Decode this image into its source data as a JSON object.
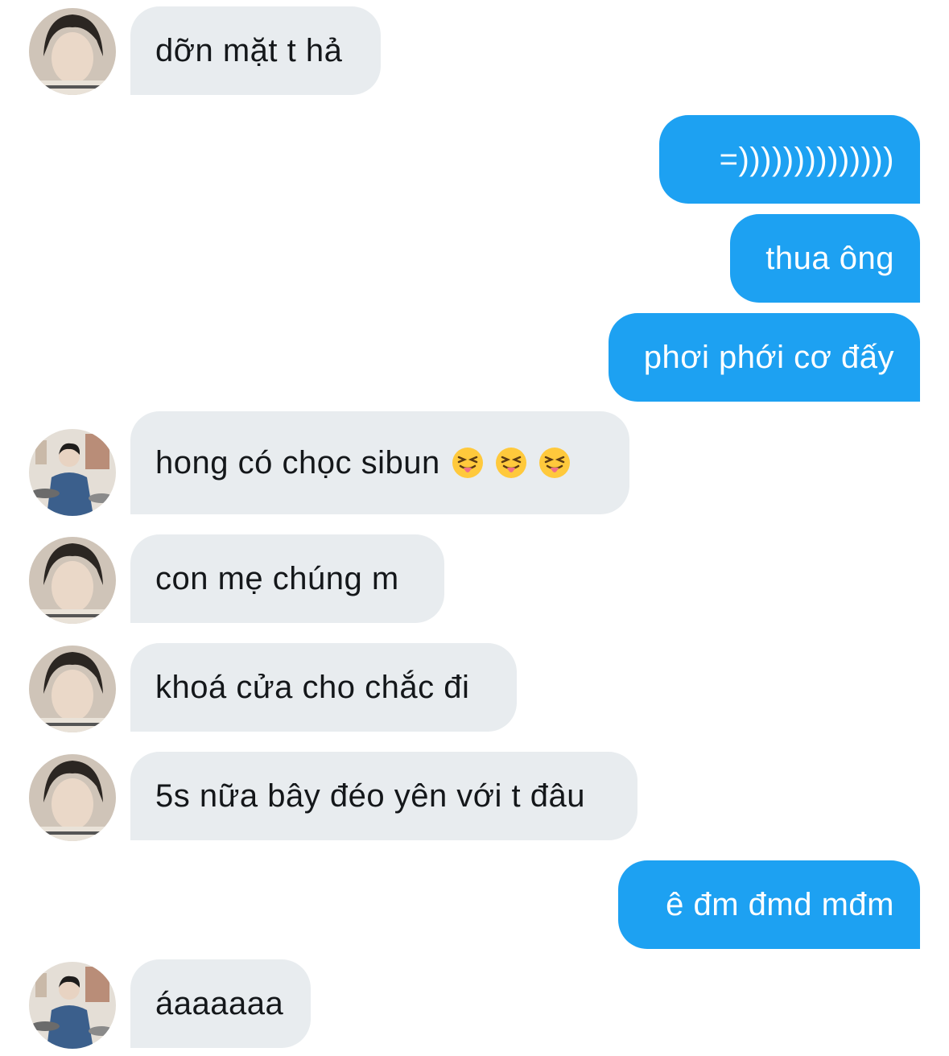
{
  "conversation": {
    "messages": [
      {
        "sender": "them",
        "avatar": "avatar-portrait-icon",
        "text": "dỡn mặt t hả"
      },
      {
        "sender": "me",
        "text": "=))))))))))))))"
      },
      {
        "sender": "me",
        "text": "thua ông"
      },
      {
        "sender": "me",
        "text": "phơi phới cơ đấy"
      },
      {
        "sender": "them",
        "avatar": "avatar-drummer-icon",
        "text": "hong có chọc sibun",
        "emoji": [
          "tongue-squint-emoji-icon",
          "tongue-squint-emoji-icon",
          "tongue-squint-emoji-icon"
        ]
      },
      {
        "sender": "them",
        "avatar": "avatar-portrait-icon",
        "text": "con mẹ chúng m"
      },
      {
        "sender": "them",
        "avatar": "avatar-portrait-icon",
        "text": "khoá cửa cho chắc đi"
      },
      {
        "sender": "them",
        "avatar": "avatar-portrait-icon",
        "text": "5s nữa bây đéo yên với t đâu"
      },
      {
        "sender": "me",
        "text": "ê đm đmd mđm"
      },
      {
        "sender": "them",
        "avatar": "avatar-drummer-icon",
        "text": "áaaaaaa"
      }
    ]
  },
  "colors": {
    "incoming_bubble": "#e8ecef",
    "outgoing_bubble": "#1da1f2",
    "incoming_text": "#14171a",
    "outgoing_text": "#ffffff"
  }
}
